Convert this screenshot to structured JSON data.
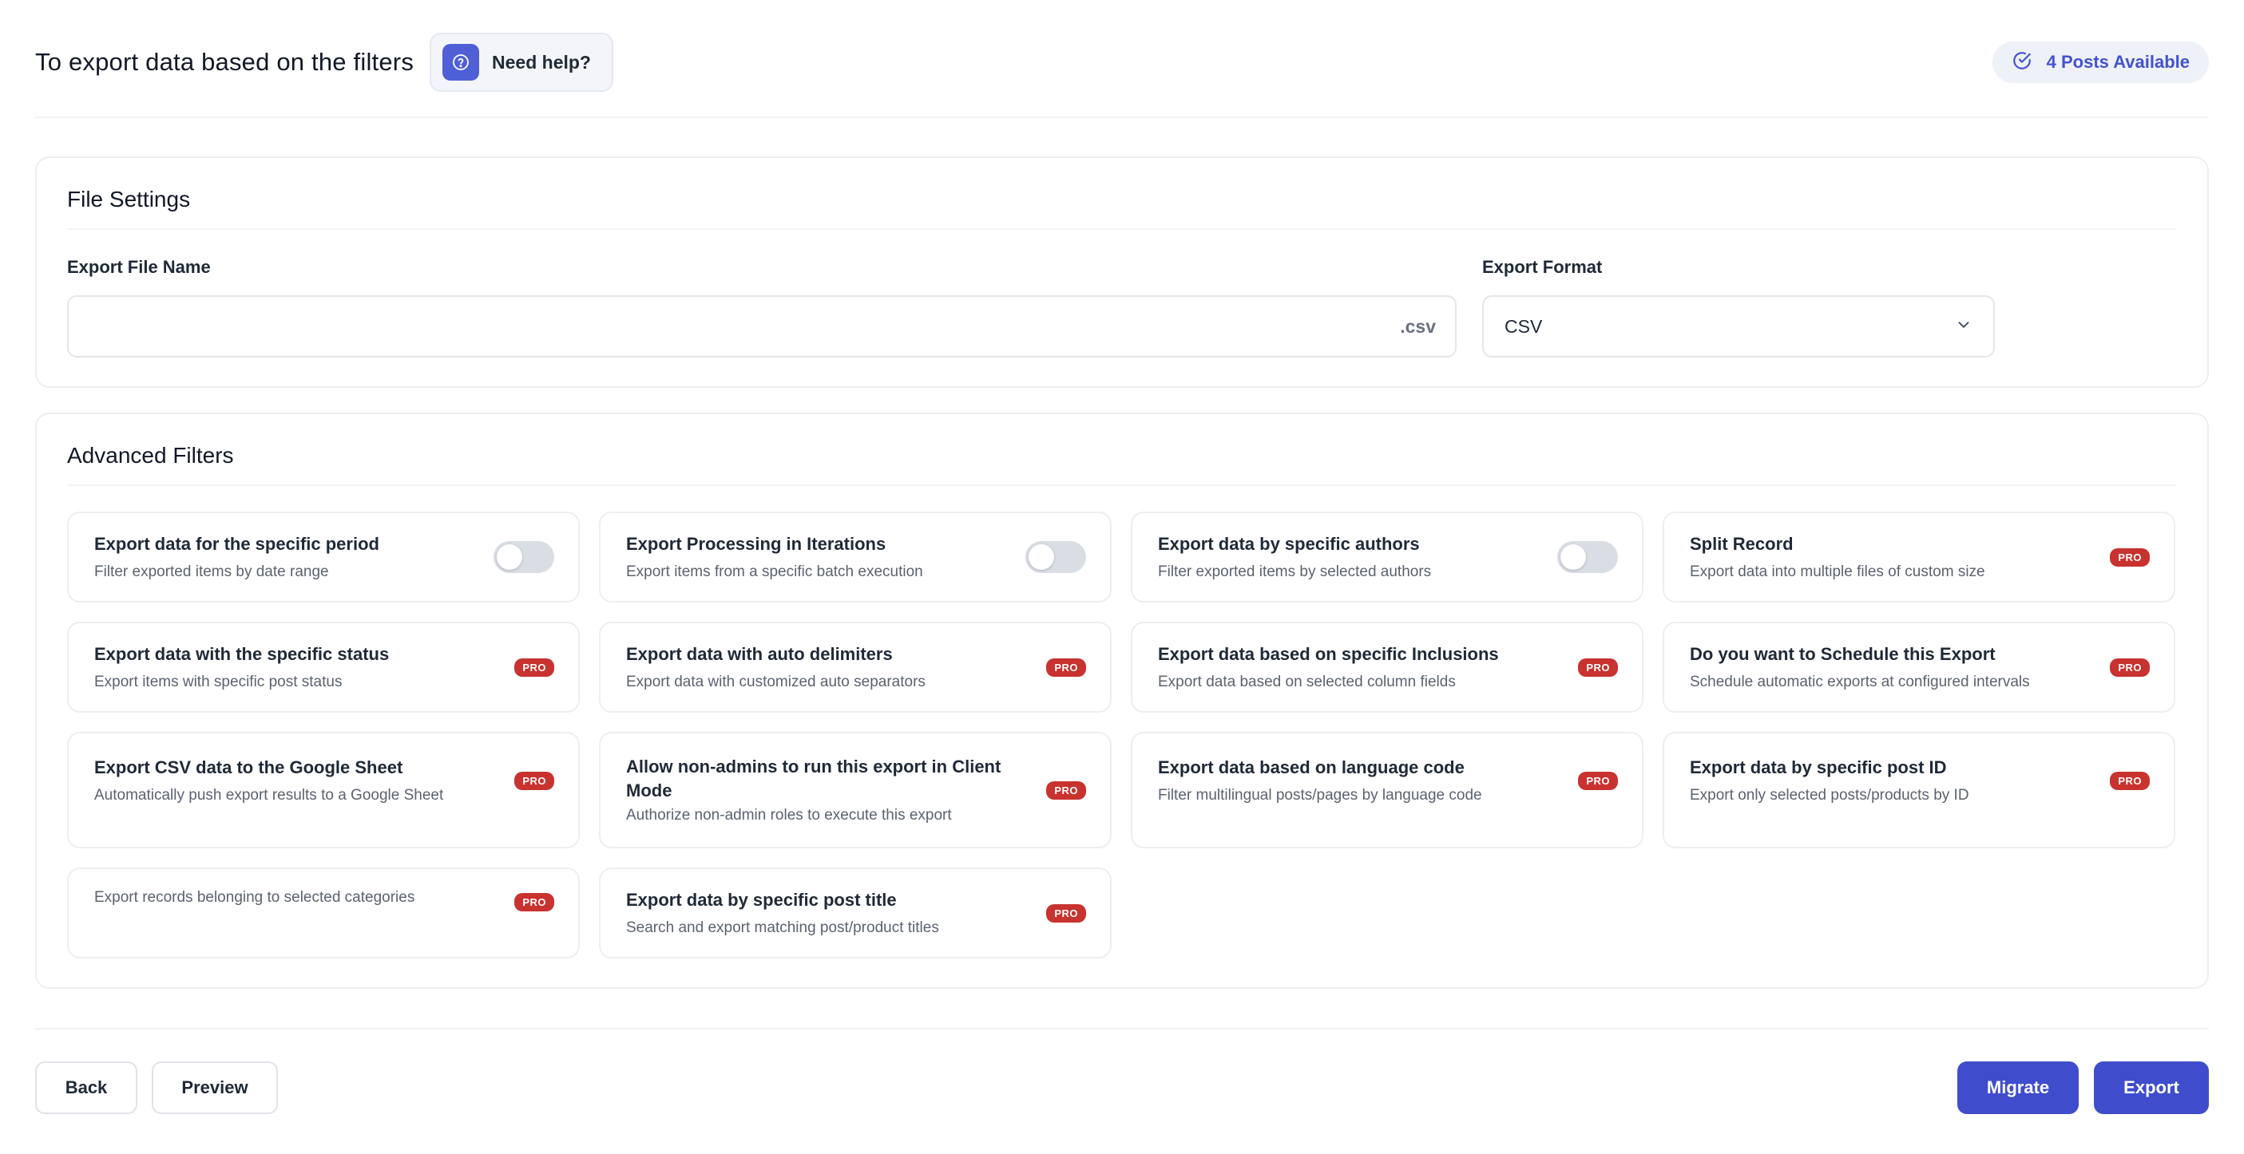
{
  "header": {
    "title": "To export data based on the filters",
    "help_label": "Need help?",
    "posts_available": "4 Posts Available"
  },
  "file_settings": {
    "title": "File Settings",
    "file_name_label": "Export File Name",
    "file_name_value": "",
    "file_extension": ".csv",
    "format_label": "Export Format",
    "format_value": "CSV"
  },
  "advanced_filters": {
    "title": "Advanced Filters",
    "items": [
      {
        "title": "Export data for the specific period",
        "subtitle": "Filter exported items by date range",
        "control": "toggle",
        "enabled": false
      },
      {
        "title": "Export Processing in Iterations",
        "subtitle": "Export items from a specific batch execution",
        "control": "toggle",
        "enabled": false
      },
      {
        "title": "Export data by specific authors",
        "subtitle": "Filter exported items by selected authors",
        "control": "toggle",
        "enabled": false
      },
      {
        "title": "Split Record",
        "subtitle": "Export data into multiple files of custom size",
        "control": "pro"
      },
      {
        "title": "Export data with the specific status",
        "subtitle": "Export items with specific post status",
        "control": "pro"
      },
      {
        "title": "Export data with auto delimiters",
        "subtitle": "Export data with customized auto separators",
        "control": "pro"
      },
      {
        "title": "Export data based on specific Inclusions",
        "subtitle": "Export data based on selected column fields",
        "control": "pro"
      },
      {
        "title": "Do you want to Schedule this Export",
        "subtitle": "Schedule automatic exports at configured intervals",
        "control": "pro"
      },
      {
        "title": "Export CSV data to the Google Sheet",
        "subtitle": "Automatically push export results to a Google Sheet",
        "control": "pro"
      },
      {
        "title": "Allow non-admins to run this export in Client Mode",
        "subtitle": "Authorize non-admin roles to execute this export",
        "control": "pro"
      },
      {
        "title": "Export data based on language code",
        "subtitle": "Filter multilingual posts/pages by language code",
        "control": "pro"
      },
      {
        "title": "Export data by specific post ID",
        "subtitle": "Export only selected posts/products by ID",
        "control": "pro"
      },
      {
        "title": "",
        "subtitle": "Export records belonging to selected categories",
        "control": "pro"
      },
      {
        "title": "Export data by specific post title",
        "subtitle": "Search and export matching post/product titles",
        "control": "pro"
      }
    ],
    "pro_label": "PRO"
  },
  "footer": {
    "back_label": "Back",
    "preview_label": "Preview",
    "migrate_label": "Migrate",
    "export_label": "Export"
  },
  "colors": {
    "primary": "#3f4dcc",
    "pro_badge": "#c8322f",
    "badge_text": "#4352cf"
  },
  "icons": {
    "help": "help-circle-icon",
    "posts": "check-circle-icon",
    "select": "chevron-down-icon"
  }
}
